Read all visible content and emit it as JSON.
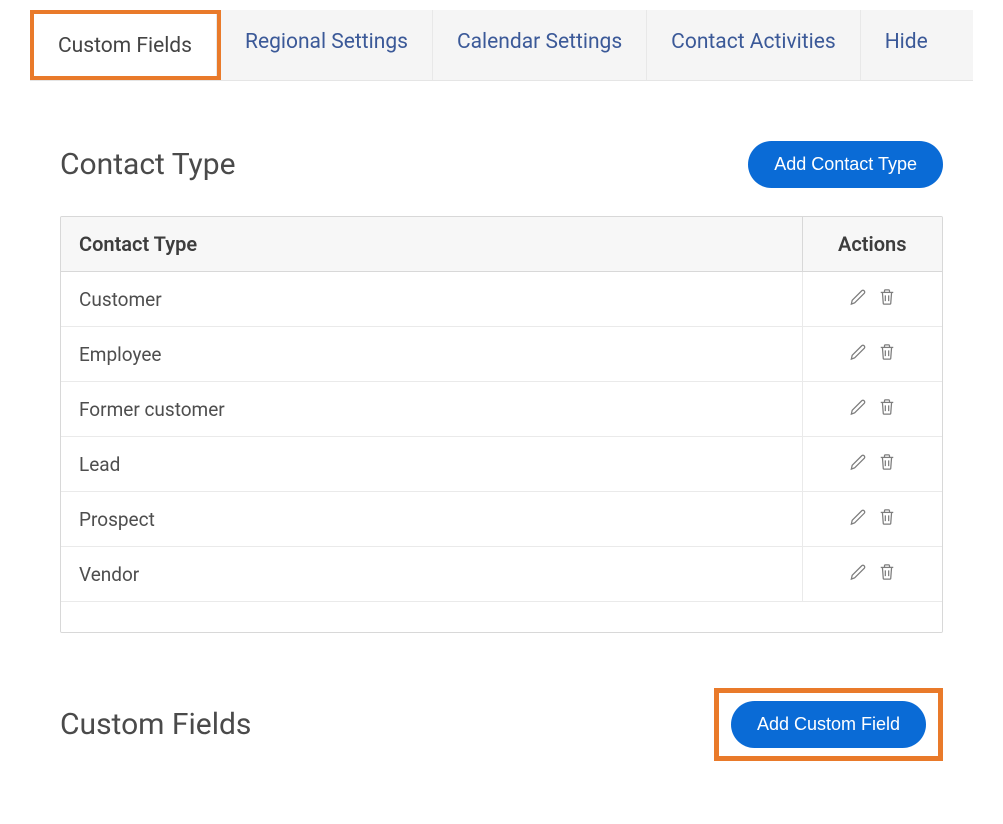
{
  "tabs": [
    {
      "label": "Custom Fields",
      "active": true
    },
    {
      "label": "Regional Settings",
      "active": false
    },
    {
      "label": "Calendar Settings",
      "active": false
    },
    {
      "label": "Contact Activities",
      "active": false
    },
    {
      "label": "Hide",
      "active": false
    }
  ],
  "section_contact_type": {
    "heading": "Contact Type",
    "add_button": "Add Contact Type",
    "col_type": "Contact Type",
    "col_actions": "Actions",
    "rows": [
      {
        "name": "Customer"
      },
      {
        "name": "Employee"
      },
      {
        "name": "Former customer"
      },
      {
        "name": "Lead"
      },
      {
        "name": "Prospect"
      },
      {
        "name": "Vendor"
      }
    ]
  },
  "section_custom_fields": {
    "heading": "Custom Fields",
    "add_button": "Add Custom Field"
  }
}
